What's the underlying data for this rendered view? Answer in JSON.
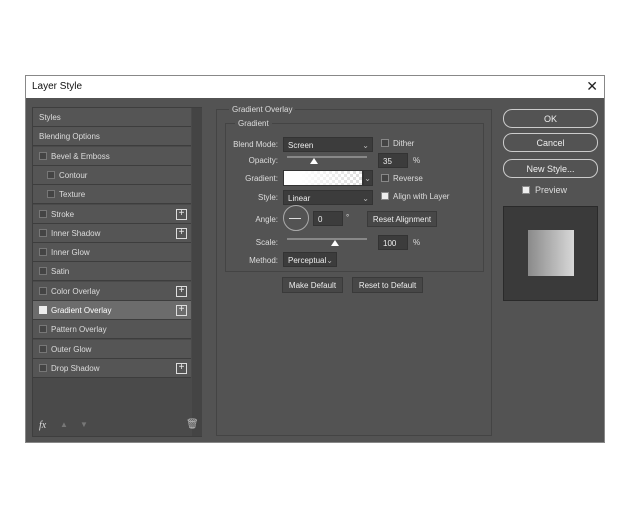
{
  "dialog": {
    "title": "Layer Style",
    "close": "✕"
  },
  "styles_list": [
    {
      "label": "Styles",
      "checkbox": false,
      "indent": false,
      "plus": false
    },
    {
      "label": "Blending Options",
      "checkbox": false,
      "indent": false,
      "plus": false
    },
    {
      "label": "Bevel & Emboss",
      "checkbox": true,
      "checked": false,
      "indent": false,
      "plus": false
    },
    {
      "label": "Contour",
      "checkbox": true,
      "checked": false,
      "indent": true,
      "plus": false
    },
    {
      "label": "Texture",
      "checkbox": true,
      "checked": false,
      "indent": true,
      "plus": false
    },
    {
      "label": "Stroke",
      "checkbox": true,
      "checked": false,
      "indent": false,
      "plus": true
    },
    {
      "label": "Inner Shadow",
      "checkbox": true,
      "checked": false,
      "indent": false,
      "plus": true
    },
    {
      "label": "Inner Glow",
      "checkbox": true,
      "checked": false,
      "indent": false,
      "plus": false
    },
    {
      "label": "Satin",
      "checkbox": true,
      "checked": false,
      "indent": false,
      "plus": false
    },
    {
      "label": "Color Overlay",
      "checkbox": true,
      "checked": false,
      "indent": false,
      "plus": true
    },
    {
      "label": "Gradient Overlay",
      "checkbox": true,
      "checked": true,
      "indent": false,
      "plus": true,
      "selected": true
    },
    {
      "label": "Pattern Overlay",
      "checkbox": true,
      "checked": false,
      "indent": false,
      "plus": false
    },
    {
      "label": "Outer Glow",
      "checkbox": true,
      "checked": false,
      "indent": false,
      "plus": false
    },
    {
      "label": "Drop Shadow",
      "checkbox": true,
      "checked": false,
      "indent": false,
      "plus": true
    }
  ],
  "bottom_icons": {
    "fx": "fx"
  },
  "panel": {
    "title": "Gradient Overlay",
    "group": "Gradient",
    "blend_mode_label": "Blend Mode:",
    "blend_mode": "Screen",
    "dither_label": "Dither",
    "opacity_label": "Opacity:",
    "opacity": "35",
    "opacity_unit": "%",
    "gradient_label": "Gradient:",
    "reverse_label": "Reverse",
    "style_label": "Style:",
    "style": "Linear",
    "align_label": "Align with Layer",
    "angle_label": "Angle:",
    "angle": "0",
    "angle_unit": "°",
    "reset_alignment": "Reset Alignment",
    "scale_label": "Scale:",
    "scale": "100",
    "scale_unit": "%",
    "method_label": "Method:",
    "method": "Perceptual",
    "make_default": "Make Default",
    "reset_default": "Reset to Default"
  },
  "right": {
    "ok": "OK",
    "cancel": "Cancel",
    "new_style": "New Style...",
    "preview": "Preview"
  }
}
